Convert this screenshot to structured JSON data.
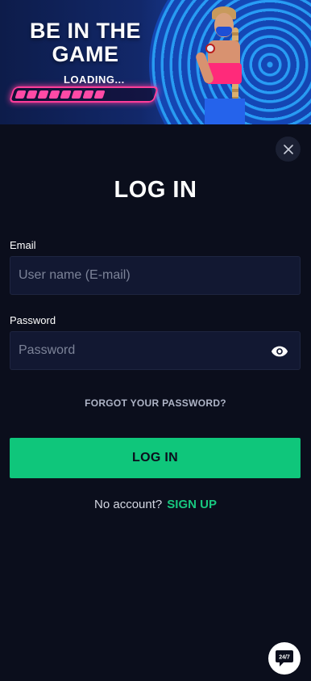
{
  "banner": {
    "headline": "BE IN THE GAME",
    "loading": "LOADING...",
    "progress": 0.62,
    "accent": "#ff3d9a"
  },
  "close": {
    "icon": "close-icon"
  },
  "title": "LOG IN",
  "email": {
    "label": "Email",
    "placeholder": "User name (E-mail)",
    "value": ""
  },
  "password": {
    "label": "Password",
    "placeholder": "Password",
    "value": "",
    "toggle_icon": "eye-icon"
  },
  "forgot": "FORGOT YOUR PASSWORD?",
  "login_button": "LOG IN",
  "signup": {
    "prompt": "No account?",
    "link": "SIGN UP"
  },
  "support": {
    "label": "24/7",
    "icon": "chat-support-icon"
  },
  "colors": {
    "background": "#0b0e1c",
    "primary": "#0fc67b",
    "input_bg": "#121832"
  }
}
